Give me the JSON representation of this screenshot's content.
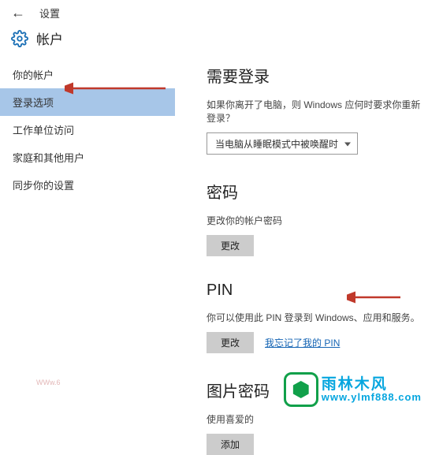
{
  "titlebar": {
    "label": "设置"
  },
  "header": {
    "title": "帐户"
  },
  "sidebar": {
    "items": [
      {
        "label": "你的帐户",
        "selected": false
      },
      {
        "label": "登录选项",
        "selected": true
      },
      {
        "label": "工作单位访问",
        "selected": false
      },
      {
        "label": "家庭和其他用户",
        "selected": false
      },
      {
        "label": "同步你的设置",
        "selected": false
      }
    ]
  },
  "sections": {
    "signin": {
      "title": "需要登录",
      "text": "如果你离开了电脑，则 Windows 应何时要求你重新登录？",
      "dropdown": "当电脑从睡眠模式中被唤醒时"
    },
    "password": {
      "title": "密码",
      "text": "更改你的帐户密码",
      "button": "更改"
    },
    "pin": {
      "title": "PIN",
      "text": "你可以使用此 PIN 登录到 Windows、应用和服务。",
      "button": "更改",
      "forgot": "我忘记了我的 PIN"
    },
    "picture": {
      "title": "图片密码",
      "text": "使用喜爱的",
      "button": "添加"
    }
  },
  "watermark": {
    "cn": "雨林木风",
    "url": "www.ylmf888.com",
    "tiny": "WWw.6"
  }
}
